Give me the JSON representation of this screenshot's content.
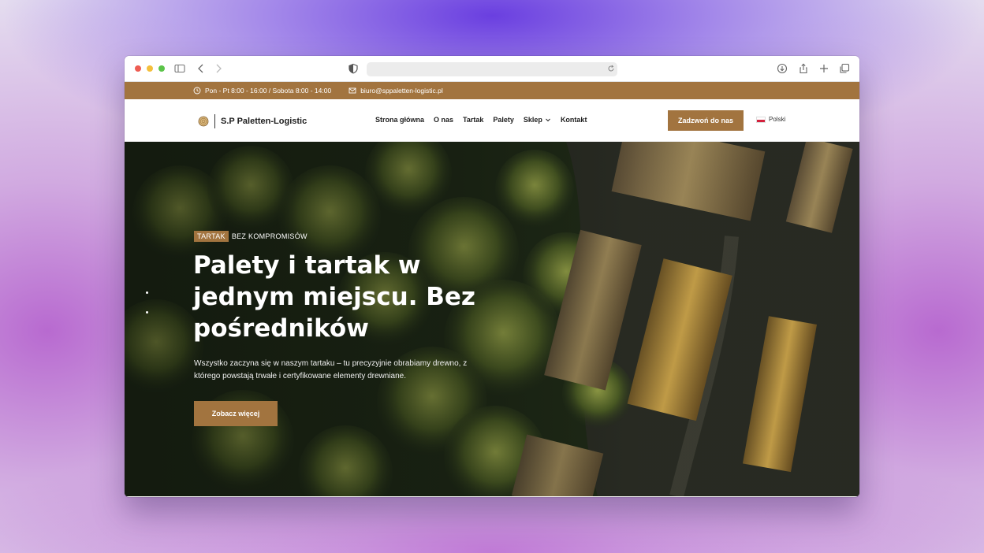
{
  "browser": {
    "icons": [
      "sidebar-icon",
      "back-icon",
      "forward-icon",
      "shield-icon",
      "reload-icon",
      "download-icon",
      "share-icon",
      "new-tab-icon",
      "tabs-overview-icon"
    ]
  },
  "topbar": {
    "hours": "Pon - Pt 8:00 - 16:00 / Sobota 8:00 - 14:00",
    "email": "biuro@sppaletten-logistic.pl"
  },
  "header": {
    "brand": "S.P Paletten-Logistic",
    "menu": [
      "Strona główna",
      "O nas",
      "Tartak",
      "Palety",
      "Sklep",
      "Kontakt"
    ],
    "cta": "Zadzwoń do nas",
    "language": "Polski"
  },
  "hero": {
    "tag": "TARTAK",
    "eyebrow": "BEZ KOMPROMISÓW",
    "headline": "Palety i tartak w jednym miejscu. Bez pośredników",
    "lead": "Wszystko zaczyna się w naszym tartaku – tu precyzyjnie obrabiamy drewno, z którego powstają trwałe i certyfikowane elementy drewniane.",
    "button": "Zobacz więcej"
  },
  "colors": {
    "accent": "#a2743f",
    "forest": "#2f3a1f",
    "text_dark": "#1e1e1e"
  }
}
